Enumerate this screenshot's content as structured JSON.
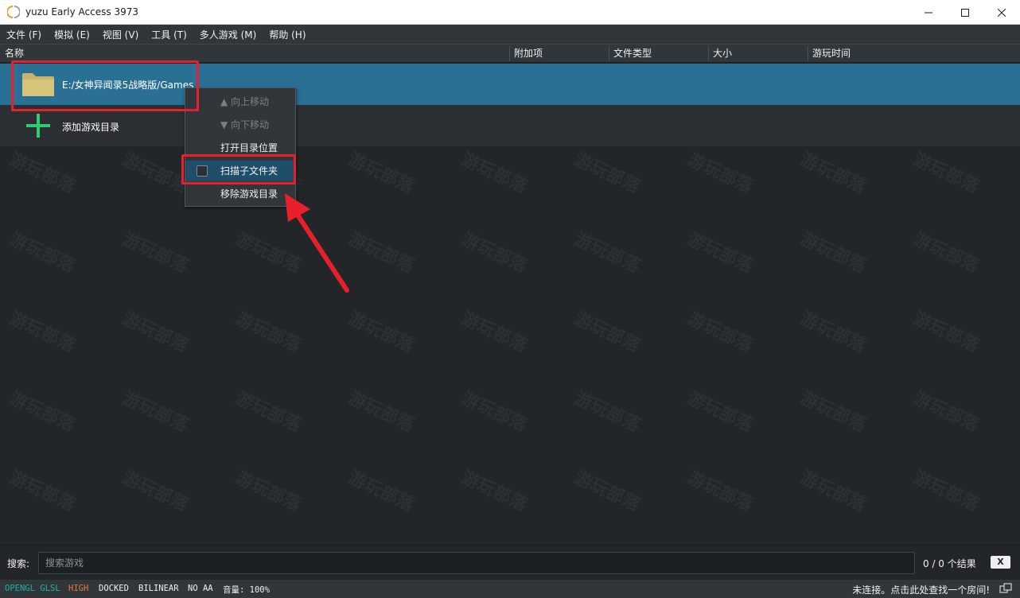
{
  "window": {
    "title": "yuzu Early Access 3973"
  },
  "menu": {
    "items": [
      "文件 (F)",
      "模拟 (E)",
      "视图 (V)",
      "工具 (T)",
      "多人游戏 (M)",
      "帮助 (H)"
    ]
  },
  "columns": {
    "name": "名称",
    "addons": "附加项",
    "file_type": "文件类型",
    "size": "大小",
    "play_time": "游玩时间"
  },
  "list": {
    "game_dir": "E:/女神异闻录5战略版/Games",
    "add_dir": "添加游戏目录"
  },
  "context_menu": {
    "move_up": "▲ 向上移动",
    "move_down": "▼ 向下移动",
    "open_location": "打开目录位置",
    "scan_subfolders": "扫描子文件夹",
    "scan_subfolders_checked": false,
    "remove_dir": "移除游戏目录"
  },
  "search": {
    "label": "搜索:",
    "placeholder": "搜索游戏",
    "result_count": "0 / 0 个结果",
    "clear_label": "X"
  },
  "status": {
    "renderer": "OPENGL GLSL",
    "accuracy": "HIGH",
    "docked": "DOCKED",
    "filter": "BILINEAR",
    "aa": "NO AA",
    "volume": "音量: 100%",
    "room": "未连接。点击此处查找一个房间!"
  },
  "watermark": "游玩部落",
  "colors": {
    "background": "#232629",
    "selection": "#2a6f94",
    "renderer_text": "#1ab3a6",
    "accuracy_text": "#e8743b",
    "plus_icon": "#2ecc71",
    "annotation_red": "#e8202b"
  }
}
